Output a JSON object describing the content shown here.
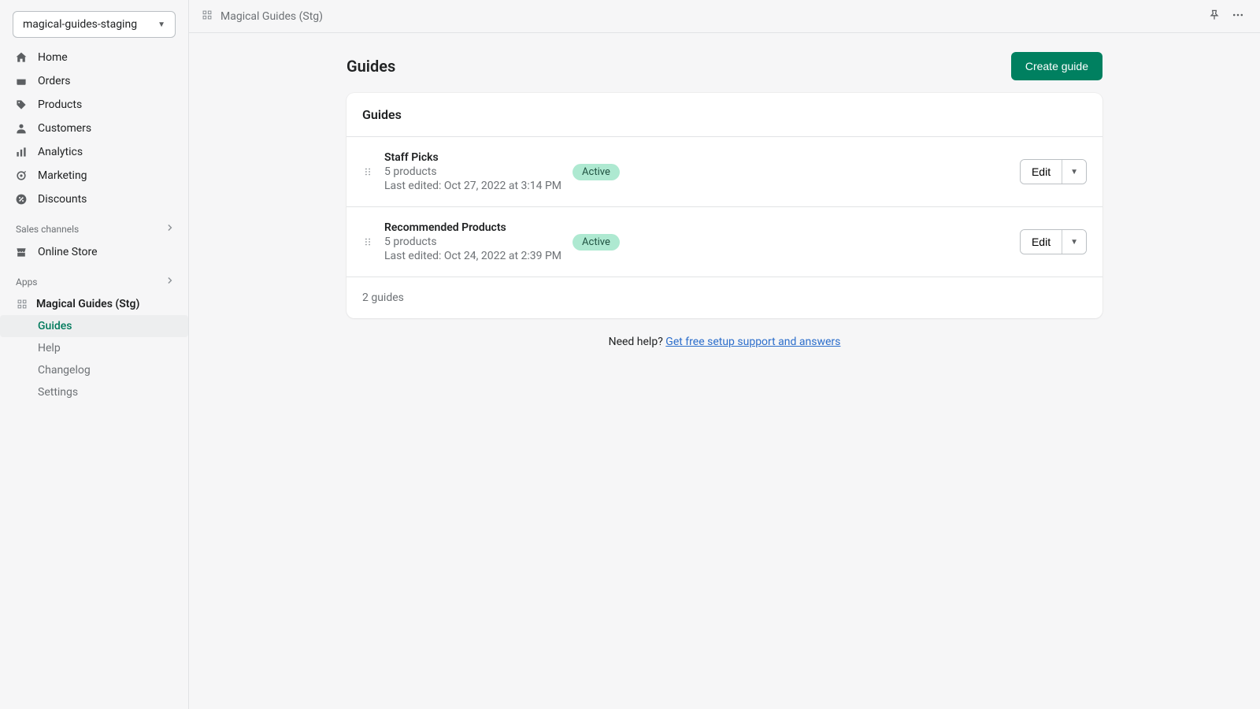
{
  "store_switcher": {
    "label": "magical-guides-staging"
  },
  "nav": {
    "items": [
      {
        "label": "Home"
      },
      {
        "label": "Orders"
      },
      {
        "label": "Products"
      },
      {
        "label": "Customers"
      },
      {
        "label": "Analytics"
      },
      {
        "label": "Marketing"
      },
      {
        "label": "Discounts"
      }
    ]
  },
  "sections": {
    "sales_channels": "Sales channels",
    "apps": "Apps"
  },
  "sales_channels": {
    "items": [
      {
        "label": "Online Store"
      }
    ]
  },
  "apps": {
    "parent": "Magical Guides (Stg)",
    "items": [
      {
        "label": "Guides",
        "active": true
      },
      {
        "label": "Help"
      },
      {
        "label": "Changelog"
      },
      {
        "label": "Settings"
      }
    ]
  },
  "topbar": {
    "breadcrumb": "Magical Guides (Stg)"
  },
  "page": {
    "title": "Guides",
    "create_button": "Create guide"
  },
  "card": {
    "header": "Guides",
    "footer": "2 guides"
  },
  "guides": [
    {
      "title": "Staff Picks",
      "subtitle": "5 products",
      "meta": "Last edited: Oct 27, 2022 at 3:14 PM",
      "status": "Active",
      "edit_label": "Edit"
    },
    {
      "title": "Recommended Products",
      "subtitle": "5 products",
      "meta": "Last edited: Oct 24, 2022 at 2:39 PM",
      "status": "Active",
      "edit_label": "Edit"
    }
  ],
  "help": {
    "prefix": "Need help? ",
    "link": "Get free setup support and answers"
  }
}
